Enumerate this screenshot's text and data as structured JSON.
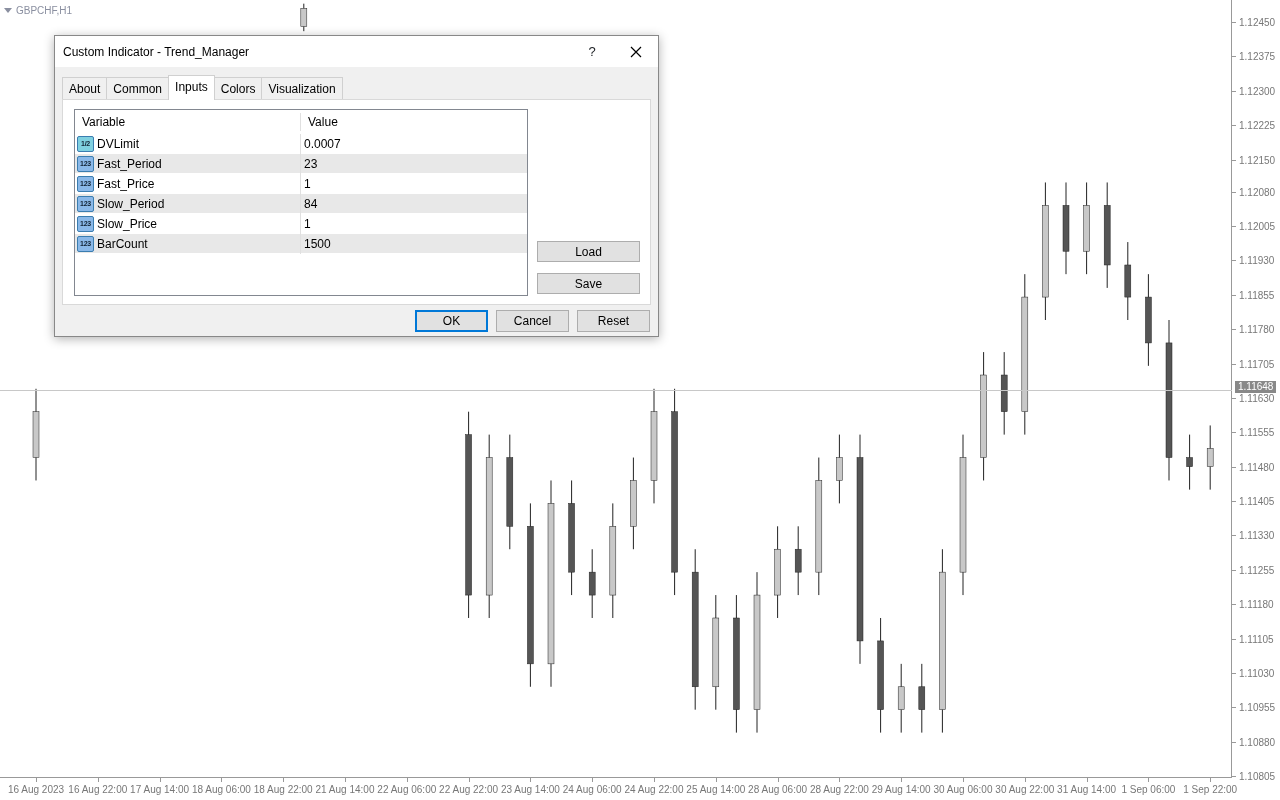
{
  "chart": {
    "symbol": "GBPCHF,H1",
    "chart_data": {
      "type": "candlestick",
      "categories": [
        "16 Aug 2023",
        null,
        null,
        "16 Aug 22:00",
        null,
        null,
        "17 Aug 14:00",
        null,
        null,
        "18 Aug 06:00",
        null,
        null,
        "18 Aug 22:00",
        null,
        null,
        "21 Aug 14:00",
        null,
        null,
        "22 Aug 06:00",
        null,
        null,
        "22 Aug 22:00",
        null,
        null,
        "23 Aug 14:00",
        null,
        null,
        "24 Aug 06:00",
        null,
        null,
        "24 Aug 22:00",
        null,
        null,
        "25 Aug 14:00",
        null,
        null,
        "28 Aug 06:00",
        null,
        null,
        "28 Aug 22:00",
        null,
        null,
        "29 Aug 14:00",
        null,
        null,
        "30 Aug 06:00",
        null,
        null,
        "30 Aug 22:00",
        null,
        null,
        "31 Aug 14:00",
        null,
        null,
        "1 Sep 06:00",
        null,
        null,
        "1 Sep 22:00"
      ],
      "ohlc": [
        [
          1.115,
          1.1165,
          1.1145,
          1.116
        ],
        null,
        null,
        null,
        null,
        null,
        null,
        null,
        null,
        null,
        null,
        null,
        null,
        [
          1.1244,
          1.1249,
          1.1243,
          1.1248
        ],
        null,
        null,
        null,
        null,
        null,
        null,
        null,
        [
          1.1155,
          1.116,
          1.1115,
          1.112
        ],
        [
          1.112,
          1.1155,
          1.1115,
          1.115
        ],
        [
          1.115,
          1.1155,
          1.113,
          1.1135
        ],
        [
          1.1135,
          1.114,
          1.11,
          1.1105
        ],
        [
          1.1105,
          1.1145,
          1.11,
          1.114
        ],
        [
          1.114,
          1.1145,
          1.112,
          1.1125
        ],
        [
          1.1125,
          1.113,
          1.1115,
          1.112
        ],
        [
          1.112,
          1.114,
          1.1115,
          1.1135
        ],
        [
          1.1135,
          1.115,
          1.113,
          1.1145
        ],
        [
          1.1145,
          1.1165,
          1.114,
          1.116
        ],
        [
          1.116,
          1.1165,
          1.112,
          1.1125
        ],
        [
          1.1125,
          1.113,
          1.1095,
          1.11
        ],
        [
          1.11,
          1.112,
          1.1095,
          1.1115
        ],
        [
          1.1115,
          1.112,
          1.109,
          1.1095
        ],
        [
          1.1095,
          1.1125,
          1.109,
          1.112
        ],
        [
          1.112,
          1.1135,
          1.1115,
          1.113
        ],
        [
          1.113,
          1.1135,
          1.112,
          1.1125
        ],
        [
          1.1125,
          1.115,
          1.112,
          1.1145
        ],
        [
          1.1145,
          1.1155,
          1.114,
          1.115
        ],
        [
          1.115,
          1.1155,
          1.1105,
          1.111
        ],
        [
          1.111,
          1.1115,
          1.109,
          1.1095
        ],
        [
          1.1095,
          1.1105,
          1.109,
          1.11
        ],
        [
          1.11,
          1.1105,
          1.109,
          1.1095
        ],
        [
          1.1095,
          1.113,
          1.109,
          1.1125
        ],
        [
          1.1125,
          1.1155,
          1.112,
          1.115
        ],
        [
          1.115,
          1.1173,
          1.1145,
          1.1168
        ],
        [
          1.1168,
          1.1173,
          1.1155,
          1.116
        ],
        [
          1.116,
          1.119,
          1.1155,
          1.1185
        ],
        [
          1.1185,
          1.121,
          1.118,
          1.1205
        ],
        [
          1.1205,
          1.121,
          1.119,
          1.1195
        ],
        [
          1.1195,
          1.121,
          1.119,
          1.1205
        ],
        [
          1.1205,
          1.121,
          1.1187,
          1.1192
        ],
        [
          1.1192,
          1.1197,
          1.118,
          1.1185
        ],
        [
          1.1185,
          1.119,
          1.117,
          1.1175
        ],
        [
          1.1175,
          1.118,
          1.1145,
          1.115
        ],
        [
          1.115,
          1.1155,
          1.1143,
          1.1148
        ],
        [
          1.1148,
          1.1157,
          1.1143,
          1.1152
        ]
      ],
      "ylim": [
        1.10801,
        1.12498
      ],
      "yticks": [
        {
          "value": 1.1245,
          "label": "1.12450"
        },
        {
          "value": 1.12375,
          "label": "1.12375"
        },
        {
          "value": 1.123,
          "label": "1.12300"
        },
        {
          "value": 1.12225,
          "label": "1.12225"
        },
        {
          "value": 1.1215,
          "label": "1.12150"
        },
        {
          "value": 1.1208,
          "label": "1.12080"
        },
        {
          "value": 1.12005,
          "label": "1.12005"
        },
        {
          "value": 1.1193,
          "label": "1.11930"
        },
        {
          "value": 1.11855,
          "label": "1.11855"
        },
        {
          "value": 1.1178,
          "label": "1.11780"
        },
        {
          "value": 1.11705,
          "label": "1.11705"
        },
        {
          "value": 1.1163,
          "label": "1.11630"
        },
        {
          "value": 1.11555,
          "label": "1.11555"
        },
        {
          "value": 1.1148,
          "label": "1.11480"
        },
        {
          "value": 1.11405,
          "label": "1.11405"
        },
        {
          "value": 1.1133,
          "label": "1.11330"
        },
        {
          "value": 1.11255,
          "label": "1.11255"
        },
        {
          "value": 1.1118,
          "label": "1.11180"
        },
        {
          "value": 1.11105,
          "label": "1.11105"
        },
        {
          "value": 1.1103,
          "label": "1.11030"
        },
        {
          "value": 1.10955,
          "label": "1.10955"
        },
        {
          "value": 1.1088,
          "label": "1.10880"
        },
        {
          "value": 1.10805,
          "label": "1.10805"
        }
      ],
      "ref_lines": [
        {
          "axis": "y",
          "value": 1.11648,
          "label": "1.11648"
        }
      ]
    }
  },
  "dialog": {
    "title": "Custom Indicator - Trend_Manager",
    "help": "?",
    "tabs": [
      {
        "label": "About",
        "selected": false
      },
      {
        "label": "Common",
        "selected": false
      },
      {
        "label": "Inputs",
        "selected": true
      },
      {
        "label": "Colors",
        "selected": false
      },
      {
        "label": "Visualization",
        "selected": false
      }
    ],
    "table": {
      "columns": [
        "Variable",
        "Value"
      ],
      "rows": [
        {
          "icon_label": "1/2",
          "color": "#7fd0e0",
          "variable": "DVLimit",
          "value": "0.0007"
        },
        {
          "icon_label": "123",
          "color": "#8ab8e8",
          "variable": "Fast_Period",
          "value": "23"
        },
        {
          "icon_label": "123",
          "color": "#8ab8e8",
          "variable": "Fast_Price",
          "value": "1"
        },
        {
          "icon_label": "123",
          "color": "#8ab8e8",
          "variable": "Slow_Period",
          "value": "84"
        },
        {
          "icon_label": "123",
          "color": "#8ab8e8",
          "variable": "Slow_Price",
          "value": "1"
        },
        {
          "icon_label": "123",
          "color": "#8ab8e8",
          "variable": "BarCount",
          "value": "1500"
        }
      ]
    },
    "side_buttons": [
      "Load",
      "Save"
    ],
    "buttons": [
      {
        "label": "OK",
        "default": true
      },
      {
        "label": "Cancel",
        "default": false
      },
      {
        "label": "Reset",
        "default": false
      }
    ]
  }
}
